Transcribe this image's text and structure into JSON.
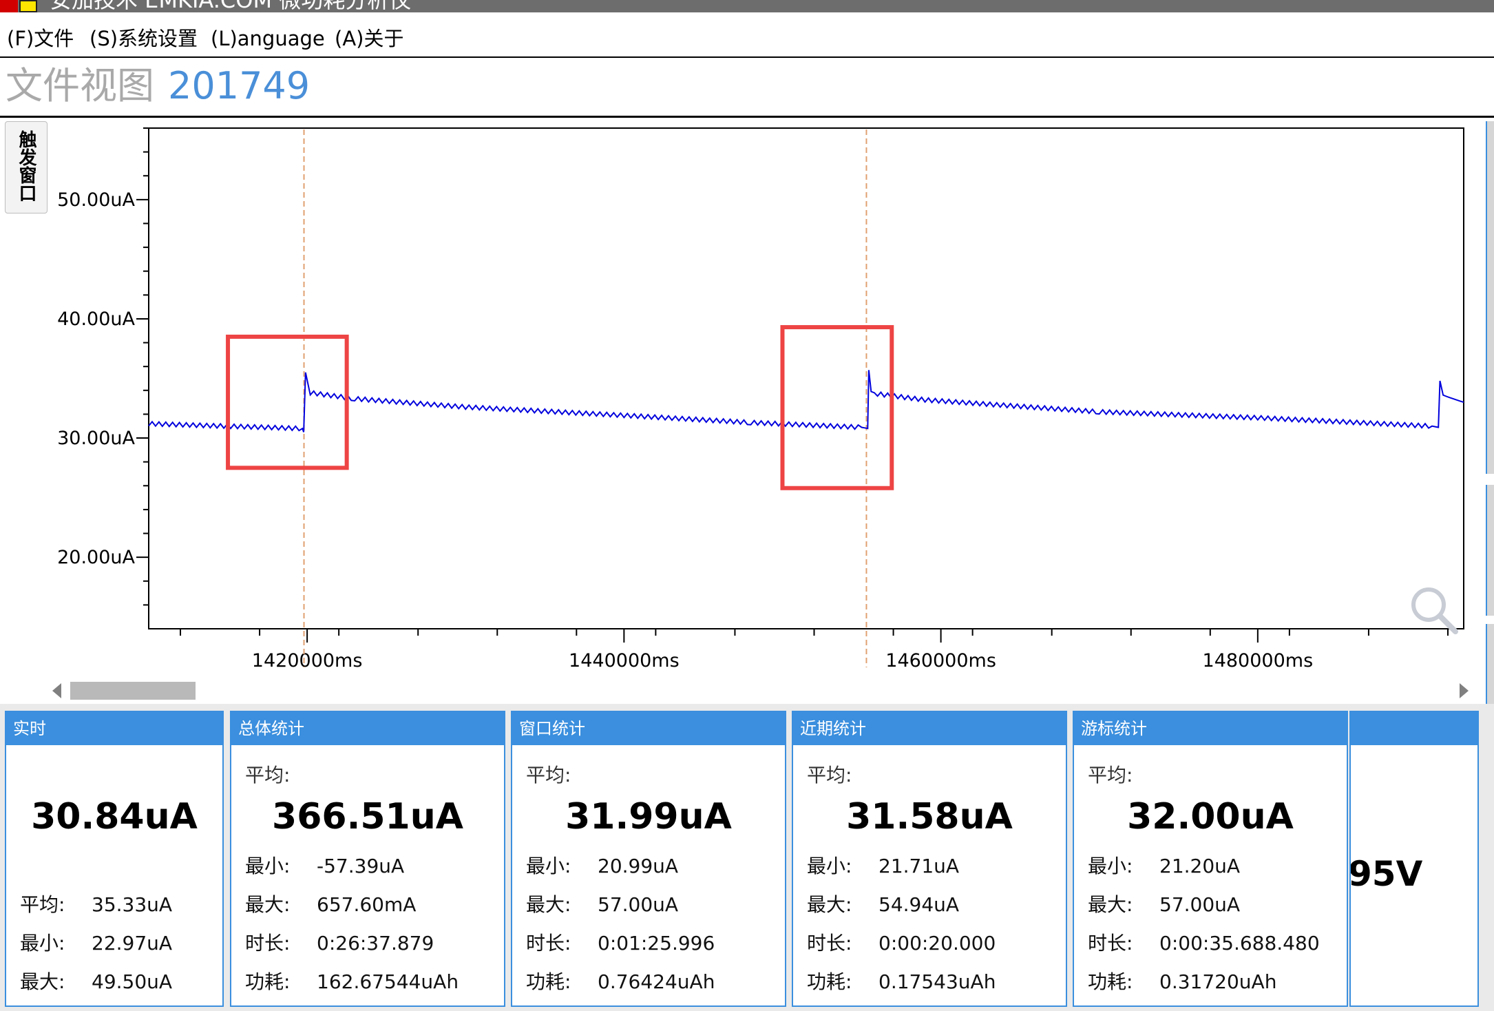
{
  "window": {
    "title": "安加技术 EMKIA.COM 微功耗分析仪",
    "colors": {
      "accent": "#3b8fde",
      "trace": "#0000dd",
      "highlight": "#ee4444",
      "cursor": "#e0a070"
    }
  },
  "menu": [
    {
      "label": "(F)文件"
    },
    {
      "label": "(S)系统设置"
    },
    {
      "label": "(L)anguage"
    },
    {
      "label": "(A)关于"
    }
  ],
  "header": {
    "title": "文件视图",
    "file_id": "201749"
  },
  "side_tab": {
    "label": "触发窗口"
  },
  "chart_data": {
    "type": "line",
    "xlim": [
      1410000,
      1493000
    ],
    "ylim": [
      14000,
      56000
    ],
    "y_ticks": [
      20000,
      30000,
      40000,
      50000
    ],
    "y_tick_labels": [
      "20.00uA",
      "30.00uA",
      "40.00uA",
      "50.00uA"
    ],
    "x_ticks": [
      1420000,
      1440000,
      1460000,
      1480000
    ],
    "x_tick_labels": [
      "1420000ms",
      "1440000ms",
      "1460000ms",
      "1480000ms"
    ],
    "cursors": [
      1419800,
      1455300
    ],
    "highlight_boxes": [
      {
        "x": [
          1415000,
          1422500
        ],
        "y": [
          27500,
          38500
        ]
      },
      {
        "x": [
          1450000,
          1456900
        ],
        "y": [
          25800,
          39300
        ]
      }
    ],
    "series": [
      {
        "x": [
          1410000,
          1419700,
          1419780,
          1419900,
          1420200,
          1423000,
          1430000,
          1440000,
          1448000,
          1455000,
          1455380,
          1455450,
          1455600,
          1456000,
          1459000,
          1470000,
          1480000,
          1491000,
          1491400,
          1491500,
          1491700,
          1492100,
          1493000
        ],
        "y": [
          31200,
          30800,
          30500,
          35500,
          33800,
          33300,
          32600,
          31900,
          31300,
          30900,
          30800,
          35700,
          33900,
          33700,
          33200,
          32200,
          31700,
          31000,
          30900,
          34800,
          33600,
          33400,
          33000
        ]
      }
    ]
  },
  "panels": [
    {
      "title": "实时",
      "big": "30.84uA",
      "rows": [
        {
          "k": "平均:",
          "v": "35.33uA"
        },
        {
          "k": "最小:",
          "v": "22.97uA"
        },
        {
          "k": "最大:",
          "v": "49.50uA"
        }
      ]
    },
    {
      "title": "总体统计",
      "avg_label": "平均:",
      "big": "366.51uA",
      "rows": [
        {
          "k": "最小:",
          "v": "-57.39uA"
        },
        {
          "k": "最大:",
          "v": "657.60mA"
        },
        {
          "k": "时长:",
          "v": "0:26:37.879"
        },
        {
          "k": "功耗:",
          "v": "162.67544uAh"
        }
      ]
    },
    {
      "title": "窗口统计",
      "avg_label": "平均:",
      "big": "31.99uA",
      "rows": [
        {
          "k": "最小:",
          "v": "20.99uA"
        },
        {
          "k": "最大:",
          "v": "57.00uA"
        },
        {
          "k": "时长:",
          "v": "0:01:25.996"
        },
        {
          "k": "功耗:",
          "v": "0.76424uAh"
        }
      ]
    },
    {
      "title": "近期统计",
      "avg_label": "平均:",
      "big": "31.58uA",
      "rows": [
        {
          "k": "最小:",
          "v": "21.71uA"
        },
        {
          "k": "最大:",
          "v": "54.94uA"
        },
        {
          "k": "时长:",
          "v": "0:00:20.000"
        },
        {
          "k": "功耗:",
          "v": "0.17543uAh"
        }
      ]
    },
    {
      "title": "游标统计",
      "avg_label": "平均:",
      "big": "32.00uA",
      "rows": [
        {
          "k": "最小:",
          "v": "21.20uA"
        },
        {
          "k": "最大:",
          "v": "57.00uA"
        },
        {
          "k": "时长:",
          "v": "0:00:35.688.480"
        },
        {
          "k": "功耗:",
          "v": "0.31720uAh"
        }
      ]
    }
  ],
  "voltage_panel": {
    "value": "95V"
  }
}
